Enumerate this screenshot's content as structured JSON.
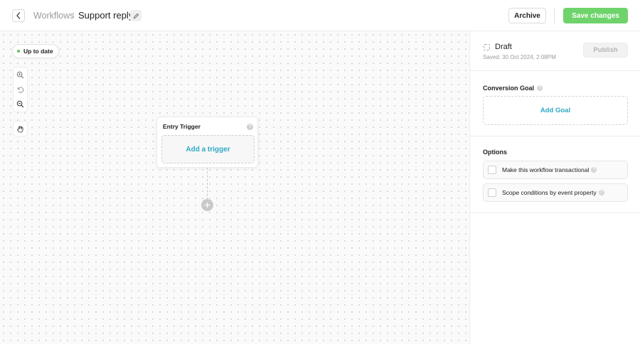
{
  "header": {
    "breadcrumb_parent": "Workflows",
    "breadcrumb_separator": "/",
    "title": "Support reply",
    "archive_label": "Archive",
    "save_label": "Save changes"
  },
  "canvas": {
    "status": "Up to date",
    "trigger_card": {
      "title": "Entry Trigger",
      "add_label": "Add a trigger"
    }
  },
  "panel": {
    "state": "Draft",
    "saved_text": "Saved: 30 Oct 2024, 2:08PM",
    "publish_label": "Publish",
    "conversion_goal": {
      "title": "Conversion Goal",
      "add_label": "Add Goal"
    },
    "options": {
      "title": "Options",
      "items": [
        {
          "label": "Make this workflow transactional"
        },
        {
          "label": "Scope conditions by event property"
        }
      ]
    }
  },
  "colors": {
    "accent": "#2ea9c4",
    "save_button": "#6ed36b",
    "status_dot": "#5fc45c"
  },
  "icons": [
    "chevron-left-icon",
    "pencil-icon",
    "zoom-in-icon",
    "undo-icon",
    "zoom-out-icon",
    "hand-icon",
    "help-icon",
    "plus-icon",
    "draft-icon"
  ]
}
